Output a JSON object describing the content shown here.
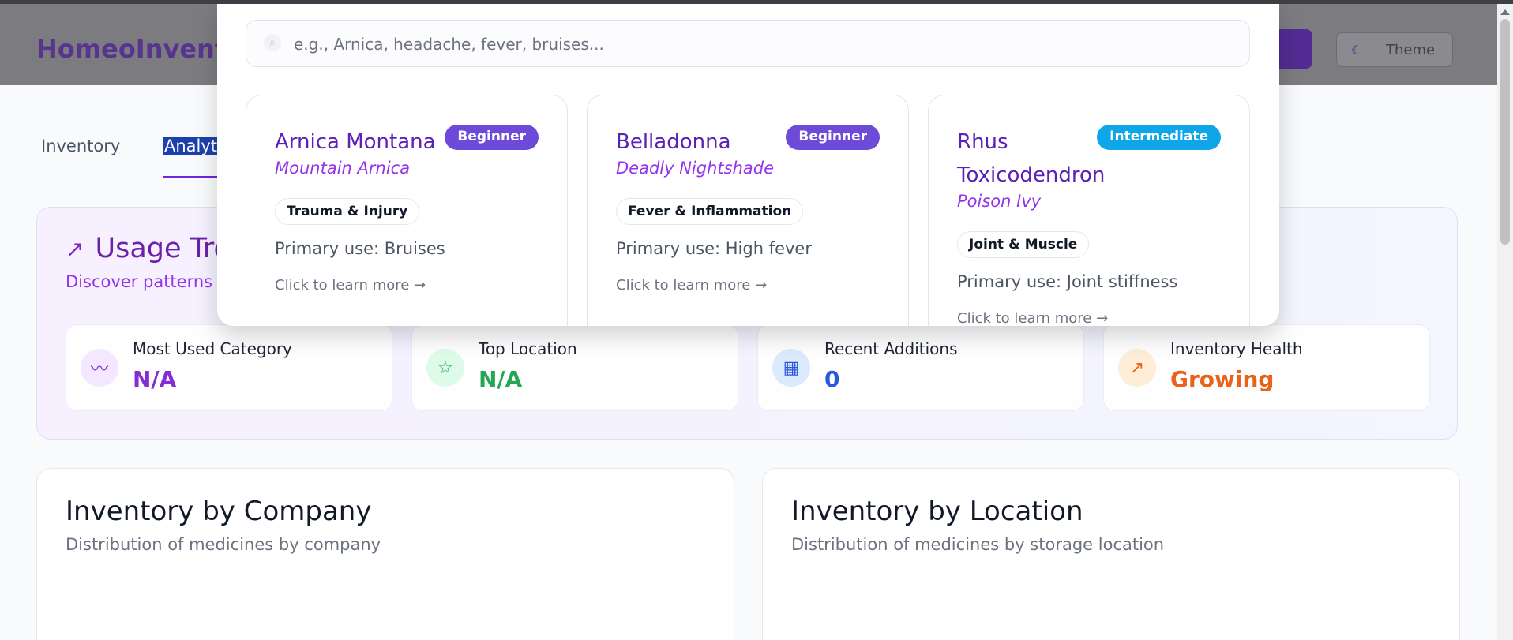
{
  "header": {
    "brand": "HomeoInventory",
    "theme_icon": "moon-icon",
    "theme_label": "Theme"
  },
  "tabs": [
    {
      "label": "Inventory"
    },
    {
      "label": "Analytics"
    }
  ],
  "trends": {
    "icon": "trending-up-icon",
    "title": "Usage Trends",
    "subtitle": "Discover patterns in your inventory",
    "stats": [
      {
        "label": "Most Used Category",
        "value": "N/A",
        "icon": "activity-icon",
        "color": "#7e22ce",
        "bg": "#f3e8ff"
      },
      {
        "label": "Top Location",
        "value": "N/A",
        "icon": "star-icon",
        "color": "#16a34a",
        "bg": "#dcfce7"
      },
      {
        "label": "Recent Additions",
        "value": "0",
        "icon": "calendar-icon",
        "color": "#1d4ed8",
        "bg": "#dbeafe"
      },
      {
        "label": "Inventory Health",
        "value": "Growing",
        "icon": "trending-up-icon",
        "color": "#ea580c",
        "bg": "#ffedd5"
      }
    ]
  },
  "panels": {
    "company": {
      "title": "Inventory by Company",
      "subtitle": "Distribution of medicines by company"
    },
    "location": {
      "title": "Inventory by Location",
      "subtitle": "Distribution of medicines by storage location"
    }
  },
  "overlay": {
    "search_placeholder": "e.g., Arnica, headache, fever, bruises...",
    "cards": [
      {
        "name": "Arnica Montana",
        "common": "Mountain Arnica",
        "level": "Beginner",
        "category": "Trauma & Injury",
        "use": "Primary use: Bruises",
        "more": "Click to learn more →"
      },
      {
        "name": "Belladonna",
        "common": "Deadly Nightshade",
        "level": "Beginner",
        "category": "Fever & Inflammation",
        "use": "Primary use: High fever",
        "more": "Click to learn more →"
      },
      {
        "name": "Rhus Toxicodendron",
        "common": "Poison Ivy",
        "level": "Intermediate",
        "category": "Joint & Muscle",
        "use": "Primary use: Joint stiffness",
        "more": "Click to learn more →"
      }
    ]
  }
}
